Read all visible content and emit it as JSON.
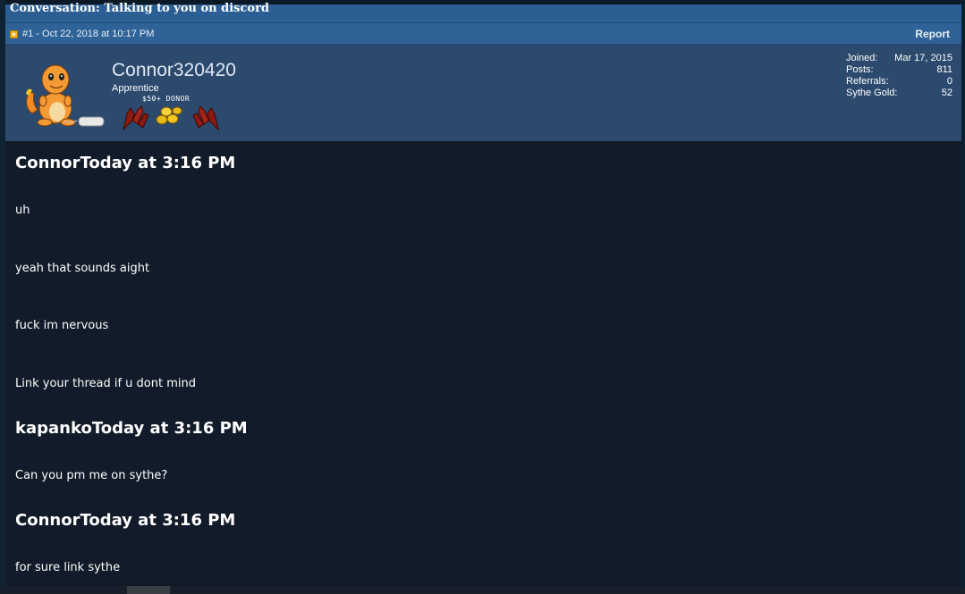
{
  "conversation": {
    "title": "Conversation: Talking to you on discord"
  },
  "post": {
    "meta": "#1 - Oct 22, 2018 at 10:17 PM",
    "report_label": "Report"
  },
  "user": {
    "name": "Connor320420",
    "title": "Apprentice",
    "donor_label": "$50+ DONOR",
    "stats": [
      {
        "label": "Joined:",
        "value": "Mar 17, 2015"
      },
      {
        "label": "Posts:",
        "value": "811"
      },
      {
        "label": "Referrals:",
        "value": "0"
      },
      {
        "label": "Sythe Gold:",
        "value": "52"
      }
    ]
  },
  "messages": [
    {
      "heading": "ConnorToday at 3:16 PM",
      "lines": [
        "uh",
        "yeah that sounds aight",
        "fuck im nervous",
        "Link your thread if u dont mind"
      ]
    },
    {
      "heading": "kapankoToday at 3:16 PM",
      "lines": [
        "Can you pm me on sythe?"
      ]
    },
    {
      "heading": "ConnorToday at 3:16 PM",
      "lines": [
        "for sure link sythe"
      ]
    }
  ],
  "colors": {
    "title_bar": "#2b5e93",
    "post_header": "#2f6397",
    "user_block": "#2c4a6d",
    "message_bg": "#111b29",
    "text": "#ffffff"
  }
}
